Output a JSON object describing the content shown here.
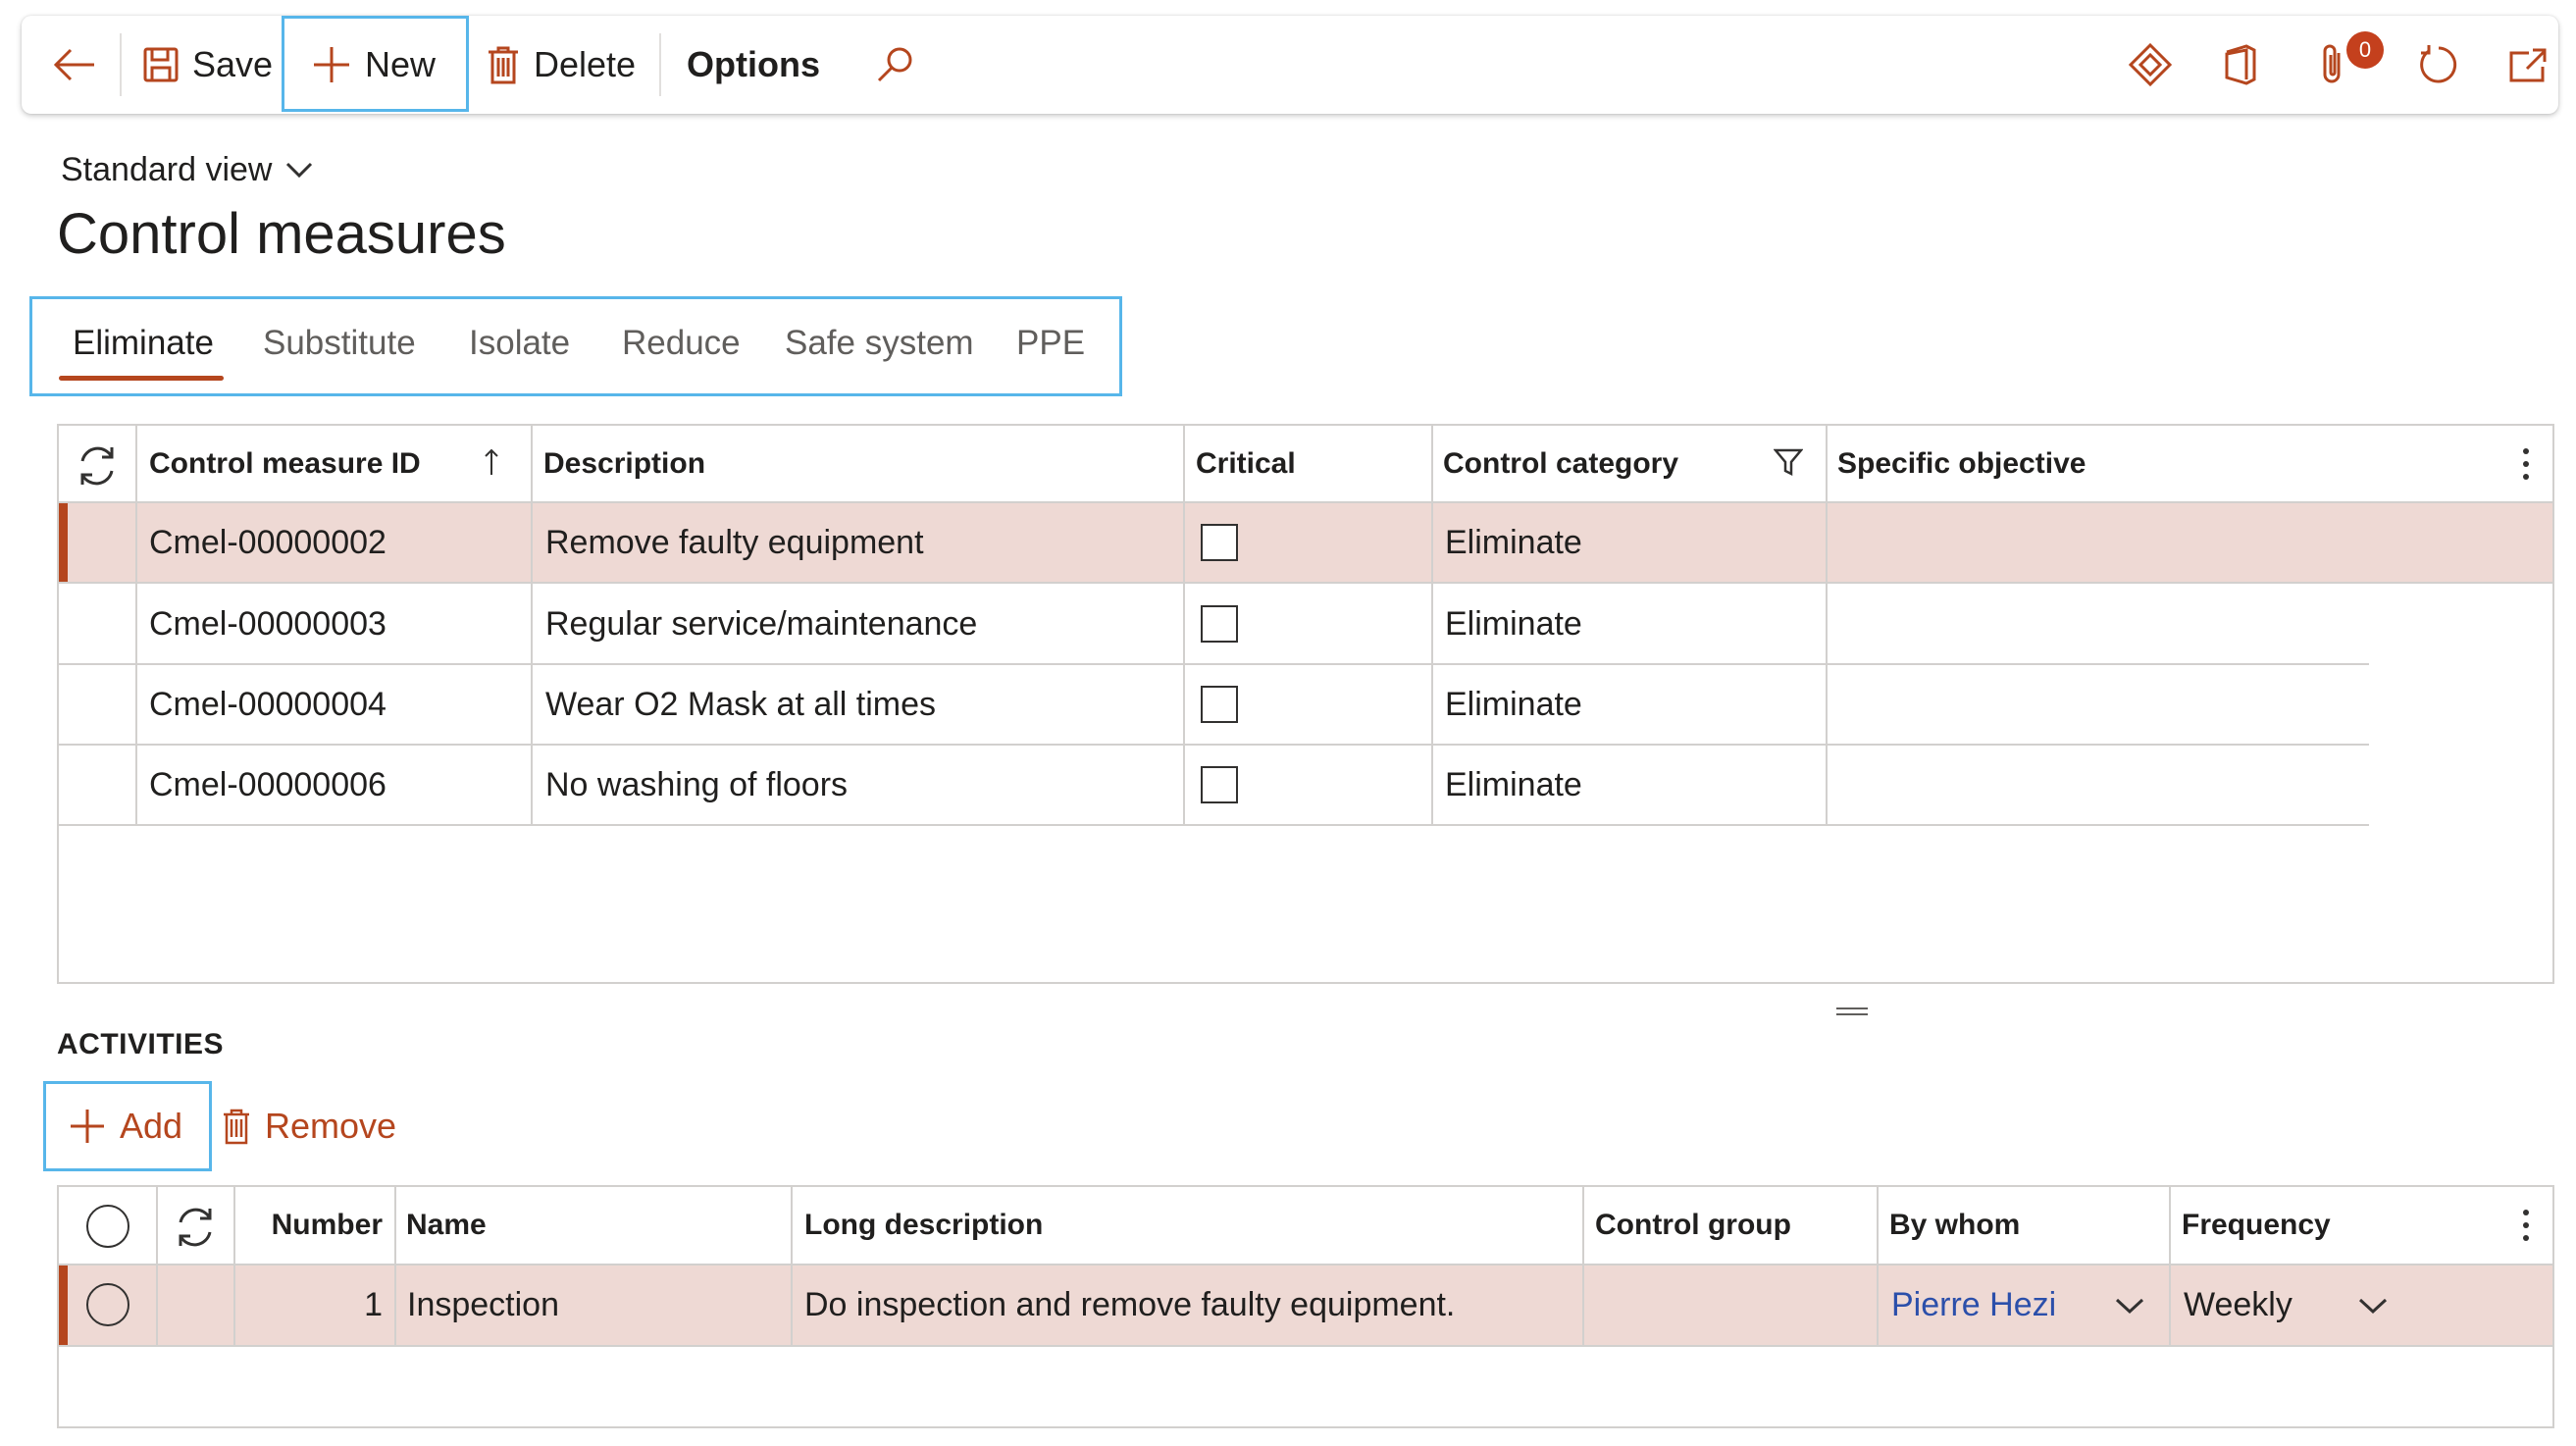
{
  "toolbar": {
    "save_label": "Save",
    "new_label": "New",
    "delete_label": "Delete",
    "options_label": "Options",
    "attachments_count": "0"
  },
  "view": {
    "name": "Standard view"
  },
  "page_title": "Control measures",
  "tabs": [
    {
      "label": "Eliminate",
      "active": true
    },
    {
      "label": "Substitute"
    },
    {
      "label": "Isolate"
    },
    {
      "label": "Reduce"
    },
    {
      "label": "Safe system"
    },
    {
      "label": "PPE"
    }
  ],
  "measures_grid": {
    "columns": [
      "Control measure ID",
      "Description",
      "Critical",
      "Control category",
      "Specific objective"
    ],
    "rows": [
      {
        "id": "Cmel-00000002",
        "description": "Remove faulty equipment",
        "critical": false,
        "category": "Eliminate",
        "objective": "",
        "selected": true
      },
      {
        "id": "Cmel-00000003",
        "description": "Regular service/maintenance",
        "critical": false,
        "category": "Eliminate",
        "objective": ""
      },
      {
        "id": "Cmel-00000004",
        "description": "Wear O2 Mask at all times",
        "critical": false,
        "category": "Eliminate",
        "objective": ""
      },
      {
        "id": "Cmel-00000006",
        "description": "No washing of floors",
        "critical": false,
        "category": "Eliminate",
        "objective": ""
      }
    ]
  },
  "activities": {
    "title": "ACTIVITIES",
    "add_label": "Add",
    "remove_label": "Remove",
    "columns": [
      "Number",
      "Name",
      "Long description",
      "Control group",
      "By whom",
      "Frequency"
    ],
    "rows": [
      {
        "number": "1",
        "name": "Inspection",
        "long_description": "Do inspection and remove faulty equipment.",
        "control_group": "",
        "by_whom": "Pierre Hezi",
        "frequency": "Weekly",
        "selected": true
      }
    ]
  },
  "colors": {
    "accent": "#b5461e",
    "selection": "#eed9d4",
    "focus": "#57b6ea",
    "link": "#2b4faa"
  }
}
